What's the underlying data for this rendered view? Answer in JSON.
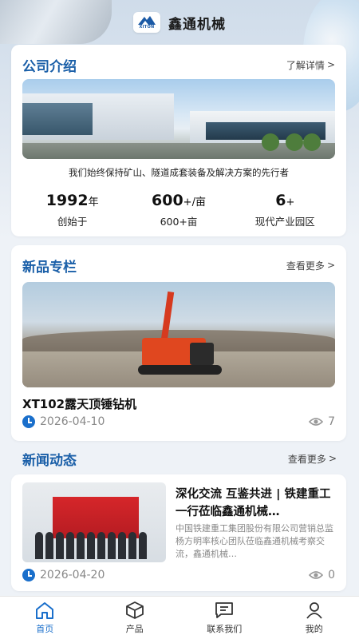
{
  "header": {
    "app_name": "鑫通机械",
    "logo_text": "XITON"
  },
  "about": {
    "title": "公司介绍",
    "more_label": "了解详情",
    "slogan": "我们始终保持矿山、隧道成套装备及解决方案的先行者",
    "stats": [
      {
        "value": "1992",
        "unit": "年",
        "label": "创始于"
      },
      {
        "value": "600",
        "unit": "+/亩",
        "label": "600+亩"
      },
      {
        "value": "6",
        "unit": "+",
        "label": "现代产业园区"
      }
    ]
  },
  "products": {
    "title": "新品专栏",
    "more_label": "查看更多",
    "item": {
      "name": "XT102露天顶锤钻机",
      "date": "2026-04-10",
      "views": "7"
    }
  },
  "news": {
    "title": "新闻动态",
    "more_label": "查看更多",
    "item": {
      "title": "深化交流 互鉴共进 | 铁建重工一行莅临鑫通机械…",
      "desc": "中国铁建重工集团股份有限公司营销总监杨方明率核心团队莅临鑫通机械考察交流，鑫通机械…",
      "date": "2026-04-20",
      "views": "0"
    }
  },
  "tabbar": {
    "items": [
      {
        "label": "首页",
        "icon": "home-icon"
      },
      {
        "label": "产品",
        "icon": "cube-icon"
      },
      {
        "label": "联系我们",
        "icon": "message-icon"
      },
      {
        "label": "我的",
        "icon": "user-icon"
      }
    ],
    "active_color": "#1a6fcb"
  },
  "colors": {
    "accent": "#1a6fcb",
    "title_blue": "#1a5fa8"
  }
}
